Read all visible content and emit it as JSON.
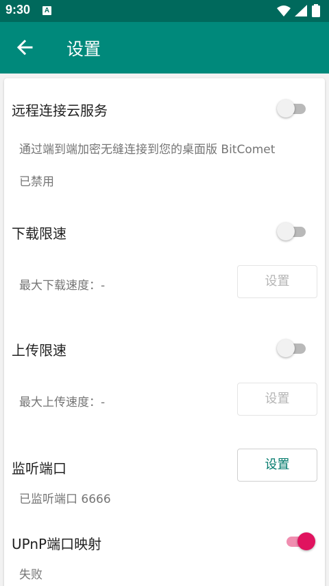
{
  "status_bar": {
    "time": "9:30",
    "badge": "A"
  },
  "app_bar": {
    "title": "设置"
  },
  "remote": {
    "label": "远程连接云服务",
    "description": "通过端到端加密无缝连接到您的桌面版 BitComet",
    "state": "已禁用",
    "enabled": false
  },
  "download_limit": {
    "label": "下载限速",
    "max_text": "最大下载速度：-",
    "button": "设置",
    "enabled": false
  },
  "upload_limit": {
    "label": "上传限速",
    "max_text": "最大上传速度：-",
    "button": "设置",
    "enabled": false
  },
  "listen_port": {
    "label": "监听端口",
    "button": "设置",
    "status": "已监听端口 6666"
  },
  "upnp": {
    "label": "UPnP端口映射",
    "status": "失败",
    "enabled": true
  },
  "colors": {
    "status_bar": "#00695c",
    "app_bar": "#00897b",
    "accent": "#e0135f",
    "button_text": "#00796b"
  }
}
